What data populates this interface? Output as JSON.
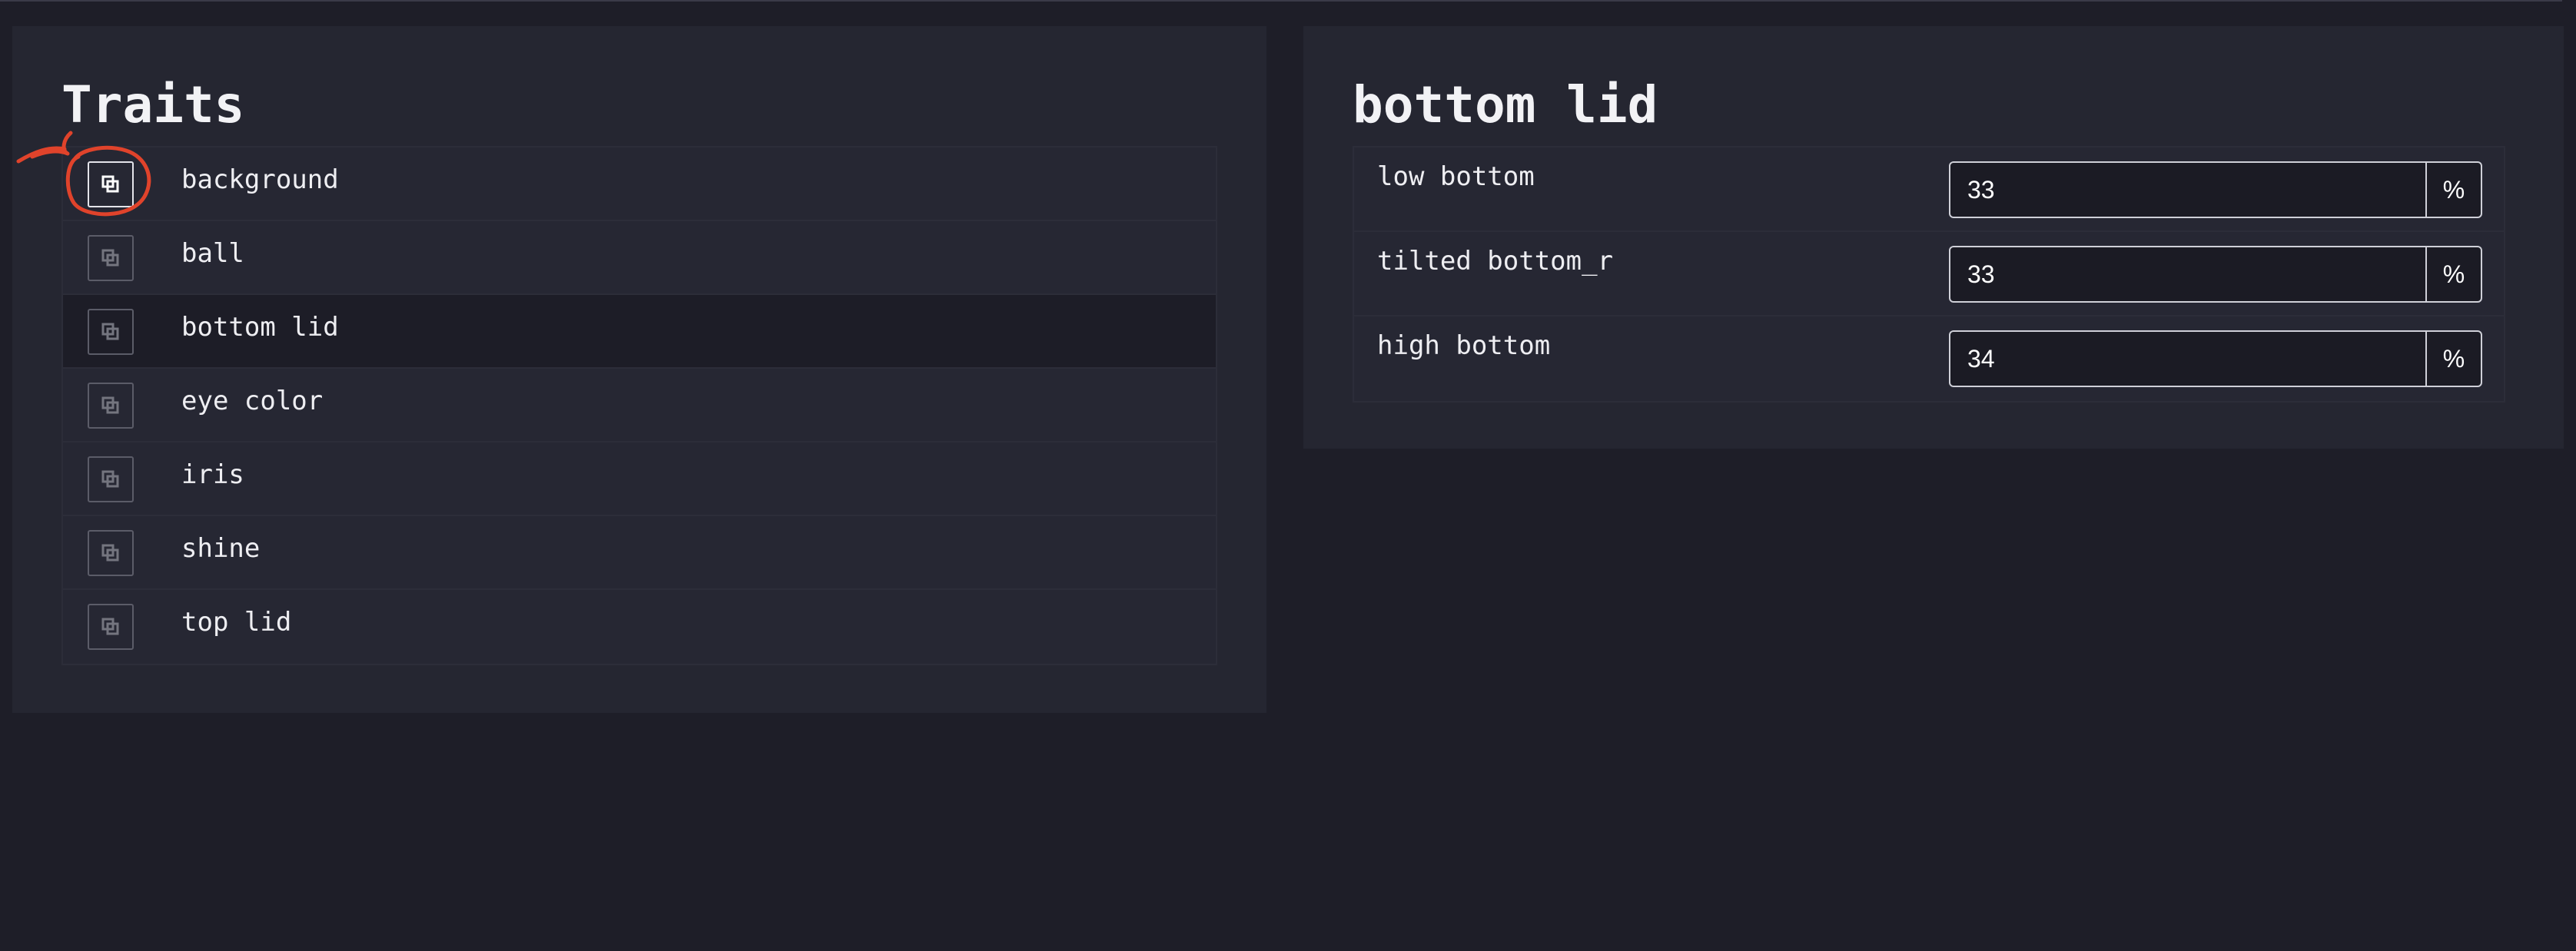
{
  "traits": {
    "title": "Traits",
    "items": [
      {
        "label": "background",
        "icon": "layers-icon",
        "active": true,
        "selected": false
      },
      {
        "label": "ball",
        "icon": "layers-icon",
        "active": false,
        "selected": false
      },
      {
        "label": "bottom lid",
        "icon": "layers-icon",
        "active": false,
        "selected": true
      },
      {
        "label": "eye color",
        "icon": "layers-icon",
        "active": false,
        "selected": false
      },
      {
        "label": "iris",
        "icon": "layers-icon",
        "active": false,
        "selected": false
      },
      {
        "label": "shine",
        "icon": "layers-icon",
        "active": false,
        "selected": false
      },
      {
        "label": "top lid",
        "icon": "layers-icon",
        "active": false,
        "selected": false
      }
    ]
  },
  "detail": {
    "title": "bottom lid",
    "fields": [
      {
        "label": "low bottom",
        "value": "33",
        "unit": "%"
      },
      {
        "label": "tilted bottom_r",
        "value": "33",
        "unit": "%"
      },
      {
        "label": "high bottom",
        "value": "34",
        "unit": "%"
      }
    ]
  },
  "colors": {
    "background": "#1e1e28",
    "panel": "#252631",
    "selected_row": "#1d1d27",
    "annotation": "#e0432b"
  }
}
